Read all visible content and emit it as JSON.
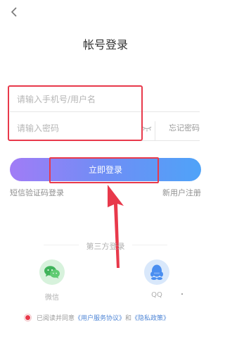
{
  "header": {
    "title": "帐号登录",
    "back_icon": "chevron-left-icon"
  },
  "form": {
    "account_placeholder": "请输入手机号/用户名",
    "password_placeholder": "请输入密码",
    "password_eye_icon": "eye-closed-icon",
    "forgot_label": "忘记密码",
    "login_label": "立即登录",
    "sms_login_label": "短信验证码登录",
    "register_label": "新用户注册"
  },
  "third_party": {
    "title": "第三方登录",
    "wechat_label": "微信",
    "qq_label": "QQ"
  },
  "agreement": {
    "prefix": "已阅读并同意",
    "user_agreement": "《用户服务协议》",
    "conjunction": "和",
    "privacy_policy": "《隐私政策》"
  },
  "colors": {
    "highlight": "#e8394b",
    "button_start": "#a17cf6",
    "button_end": "#4fa3f8",
    "link": "#4f86d6"
  }
}
